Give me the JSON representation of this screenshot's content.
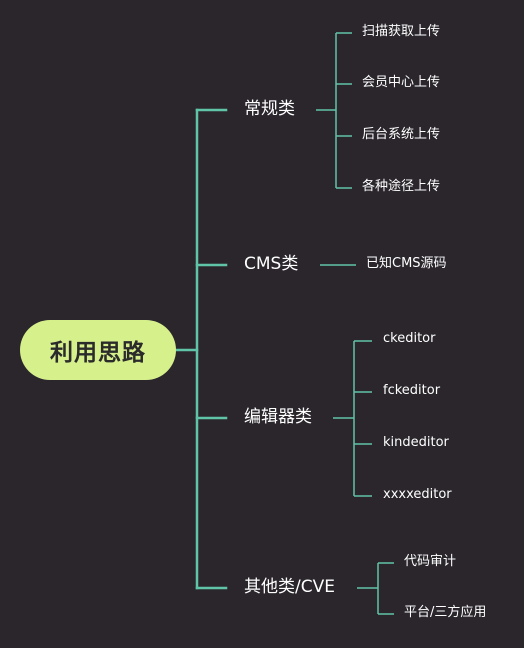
{
  "root": {
    "label": "利用思路"
  },
  "branches": [
    {
      "label": "常规类",
      "children": [
        "扫描获取上传",
        "会员中心上传",
        "后台系统上传",
        "各种途径上传"
      ]
    },
    {
      "label": "CMS类",
      "children": [
        "已知CMS源码"
      ]
    },
    {
      "label": "编辑器类",
      "children": [
        "ckeditor",
        "fckeditor",
        "kindeditor",
        "xxxxeditor"
      ]
    },
    {
      "label": "其他类/CVE",
      "children": [
        "代码审计",
        "平台/三方应用"
      ]
    }
  ],
  "colors": {
    "background": "#2a262c",
    "line": "#5fc4a8",
    "root_fill": "#d6f08c",
    "text": "#ffffff"
  }
}
